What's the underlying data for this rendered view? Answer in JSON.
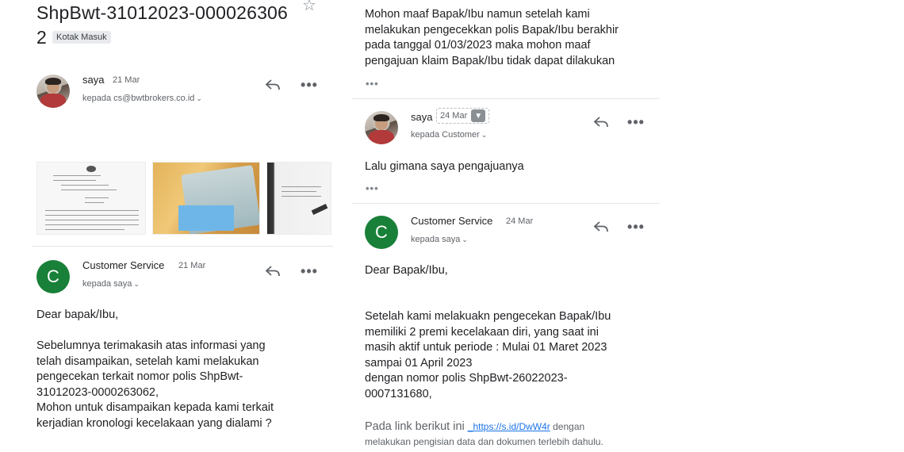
{
  "email": {
    "subject_line1": "ShpBwt-31012023-000026306",
    "subject_line2": "2",
    "label": "Kotak Masuk"
  },
  "messages": [
    {
      "sender": "saya",
      "date": "21 Mar",
      "to": "kepada cs@bwtbrokers.co.id"
    },
    {
      "sender": "Customer Service",
      "date": "21 Mar",
      "to": "kepada saya",
      "avatar_letter": "C",
      "body": "Dear bapak/Ibu,\n\nSebelumnya terimakasih atas informasi yang\ntelah disampaikan, setelah kami melakukan\npengecekan terkait nomor polis ShpBwt-\n31012023-0000263062,\nMohon untuk disampaikan kepada kami terkait\nkerjadian kronologi kecelakaan yang dialami ?"
    },
    {
      "quoted_body": "Mohon maaf Bapak/Ibu namun setelah kami\nmelakukan pengecekkan polis Bapak/Ibu berakhir\npada tanggal  01/03/2023 maka mohon maaf\npengajuan klaim Bapak/Ibu tidak dapat dilakukan"
    },
    {
      "sender": "saya",
      "date": "24 Mar",
      "to": "kepada Customer",
      "body": "Lalu gimana saya pengajuanya"
    },
    {
      "sender": "Customer Service",
      "date": "24 Mar",
      "to": "kepada saya",
      "avatar_letter": "C",
      "greeting": "Dear Bapak/Ibu,",
      "body": "Setelah kami melakuakn pengecekan Bapak/Ibu\nmemiliki 2 premi kecelakaan diri, yang saat ini\nmasih aktif untuk periode : Mulai 01 Maret 2023\nsampai 01 April 2023\ndengan nomor polis ShpBwt-26022023-\n0007131680,",
      "link_prefix": "Pada link berikut ini ",
      "link": "_https://s.id/DwW4r",
      "link_suffix": " dengan",
      "footer": "melakukan pengisian data dan dokumen terlebih dahulu."
    }
  ],
  "ui": {
    "ellipsis": "•••",
    "chevron": "⌄"
  },
  "icons": {
    "star": "star-icon",
    "reply": "reply-icon",
    "more": "more-icon",
    "dropdown": "dropdown-icon"
  },
  "colors": {
    "avatar_green": "#188038",
    "link_blue": "#1a73e8",
    "text": "#202124",
    "muted": "#5f6368"
  }
}
